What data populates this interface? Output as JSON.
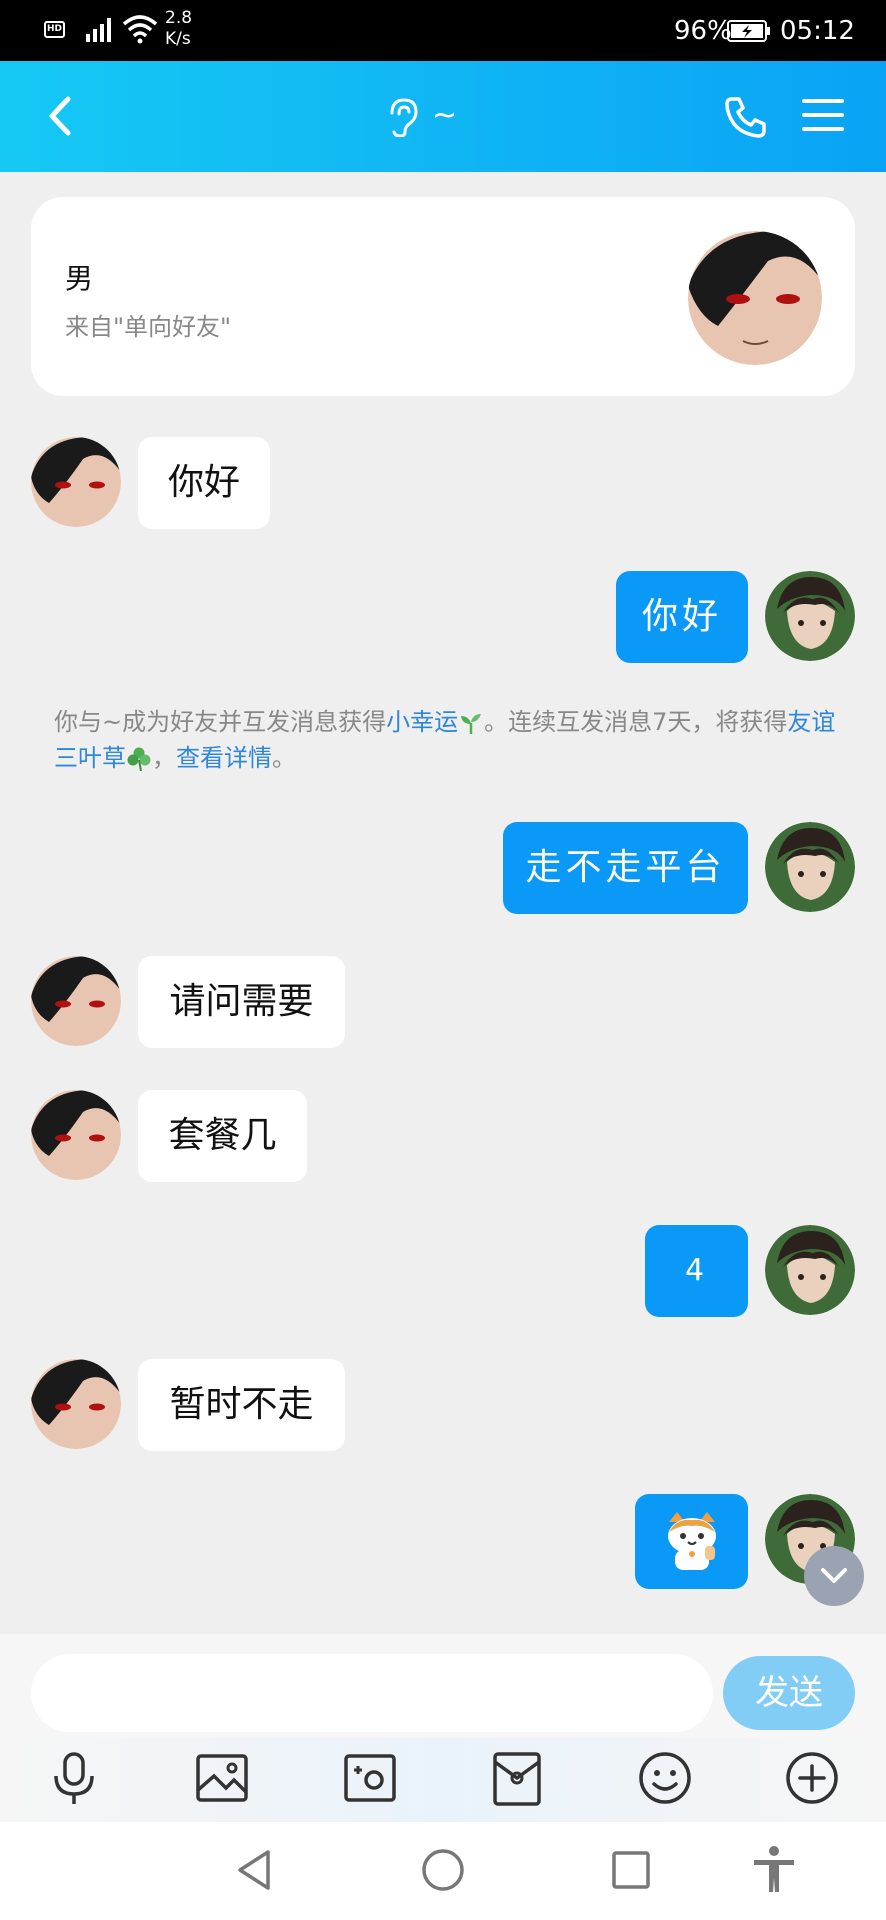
{
  "status_bar": {
    "hd_label": "HD",
    "speed_value": "2.8",
    "speed_unit": "K/s",
    "battery_percent": "96%",
    "time": "05:12"
  },
  "header": {
    "title": "~"
  },
  "profile_card": {
    "gender": "男",
    "source": "来自\"单向好友\""
  },
  "messages": {
    "m1": "你好",
    "m2": "你好",
    "m3": "走不走平台",
    "m4": "请问需要",
    "m5": "套餐几",
    "m6": "4",
    "m7": "暂时不走"
  },
  "system_note": {
    "part1": "你与~成为好友并互发消息获得",
    "link1": "小幸运",
    "part2": "。连续互发消息7天，将获得",
    "link2": "友谊三叶草",
    "part3": "，",
    "link3": "查看详情",
    "part4": "。"
  },
  "input_bar": {
    "placeholder": "",
    "send_label": "发送"
  },
  "colors": {
    "header_start": "#16c9f4",
    "header_end": "#0aa3f5",
    "bubble_out": "#0b99f8",
    "link": "#2f87d8"
  },
  "icons": [
    "back-icon",
    "ear-icon",
    "phone-icon",
    "menu-icon",
    "scroll-down-icon",
    "microphone-icon",
    "image-icon",
    "camera-icon",
    "red-packet-icon",
    "emoji-icon",
    "plus-icon",
    "nav-back-icon",
    "nav-home-icon",
    "nav-recents-icon",
    "accessibility-icon"
  ]
}
